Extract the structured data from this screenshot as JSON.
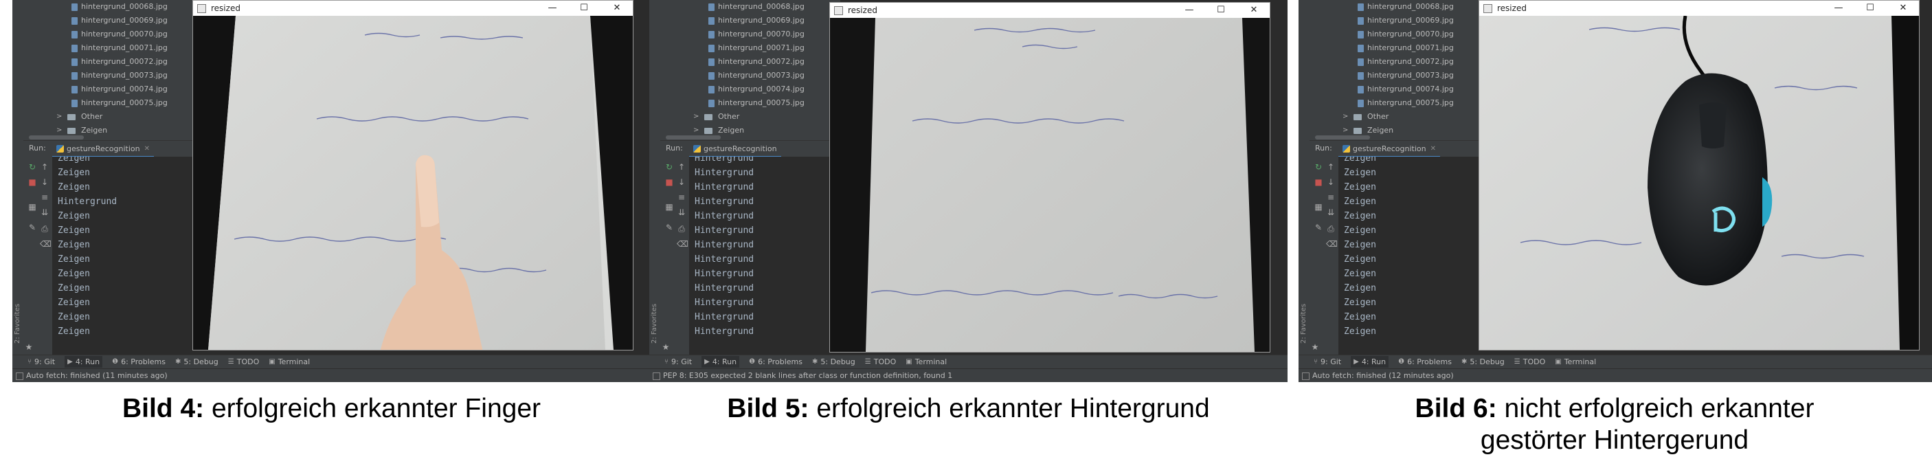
{
  "panels": [
    {
      "files": [
        "hintergrund_00068.jpg",
        "hintergrund_00069.jpg",
        "hintergrund_00070.jpg",
        "hintergrund_00071.jpg",
        "hintergrund_00072.jpg",
        "hintergrund_00073.jpg",
        "hintergrund_00074.jpg",
        "hintergrund_00075.jpg"
      ],
      "folders": [
        "Other",
        "Zeigen"
      ],
      "run_label": "Run:",
      "run_tab": "gestureRecognition",
      "console": [
        "Zeigen",
        "Zeigen",
        "Zeigen",
        "Hintergrund",
        "Zeigen",
        "Zeigen",
        "Zeigen",
        "Zeigen",
        "Zeigen",
        "Zeigen",
        "Zeigen",
        "Zeigen",
        "Zeigen"
      ],
      "window_title": "resized",
      "status_message": "Auto fetch: finished (11 minutes ago)",
      "caption_bold": "Bild 4:",
      "caption_text": " erfolgreich erkannter Finger",
      "scene": "finger"
    },
    {
      "files": [
        "hintergrund_00068.jpg",
        "hintergrund_00069.jpg",
        "hintergrund_00070.jpg",
        "hintergrund_00071.jpg",
        "hintergrund_00072.jpg",
        "hintergrund_00073.jpg",
        "hintergrund_00074.jpg",
        "hintergrund_00075.jpg"
      ],
      "folders": [
        "Other",
        "Zeigen"
      ],
      "run_label": "Run:",
      "run_tab": "gestureRecognition",
      "console": [
        "Hintergrund",
        "Hintergrund",
        "Hintergrund",
        "Hintergrund",
        "Hintergrund",
        "Hintergrund",
        "Hintergrund",
        "Hintergrund",
        "Hintergrund",
        "Hintergrund",
        "Hintergrund",
        "Hintergrund",
        "Hintergrund"
      ],
      "window_title": "resized",
      "status_message": "PEP 8: E305 expected 2 blank lines after class or function definition, found 1",
      "caption_bold": "Bild 5:",
      "caption_text": " erfolgreich erkannter Hintergrund",
      "scene": "paper"
    },
    {
      "files": [
        "hintergrund_00068.jpg",
        "hintergrund_00069.jpg",
        "hintergrund_00070.jpg",
        "hintergrund_00071.jpg",
        "hintergrund_00072.jpg",
        "hintergrund_00073.jpg",
        "hintergrund_00074.jpg",
        "hintergrund_00075.jpg"
      ],
      "folders": [
        "Other",
        "Zeigen"
      ],
      "run_label": "Run:",
      "run_tab": "gestureRecognition",
      "console": [
        "Zeigen",
        "Zeigen",
        "Zeigen",
        "Zeigen",
        "Zeigen",
        "Zeigen",
        "Zeigen",
        "Zeigen",
        "Zeigen",
        "Zeigen",
        "Zeigen",
        "Zeigen",
        "Zeigen"
      ],
      "window_title": "resized",
      "status_message": "Auto fetch: finished (12 minutes ago)",
      "caption_bold": "Bild 6:",
      "caption_text": " nicht erfolgreich erkannter gestörter Hintergerund",
      "scene": "mouse"
    }
  ],
  "bottom_tabs": [
    "9: Git",
    "4: Run",
    "6: Problems",
    "5: Debug",
    "TODO",
    "Terminal"
  ],
  "favorites_label": "2: Favorites",
  "window_controls": [
    "—",
    "☐",
    "✕"
  ],
  "colors": {
    "ide_bg": "#2b2b2b",
    "panel_bg": "#3c3f41",
    "console_text": "#a9b7c6",
    "accent": "#4a88c7"
  }
}
